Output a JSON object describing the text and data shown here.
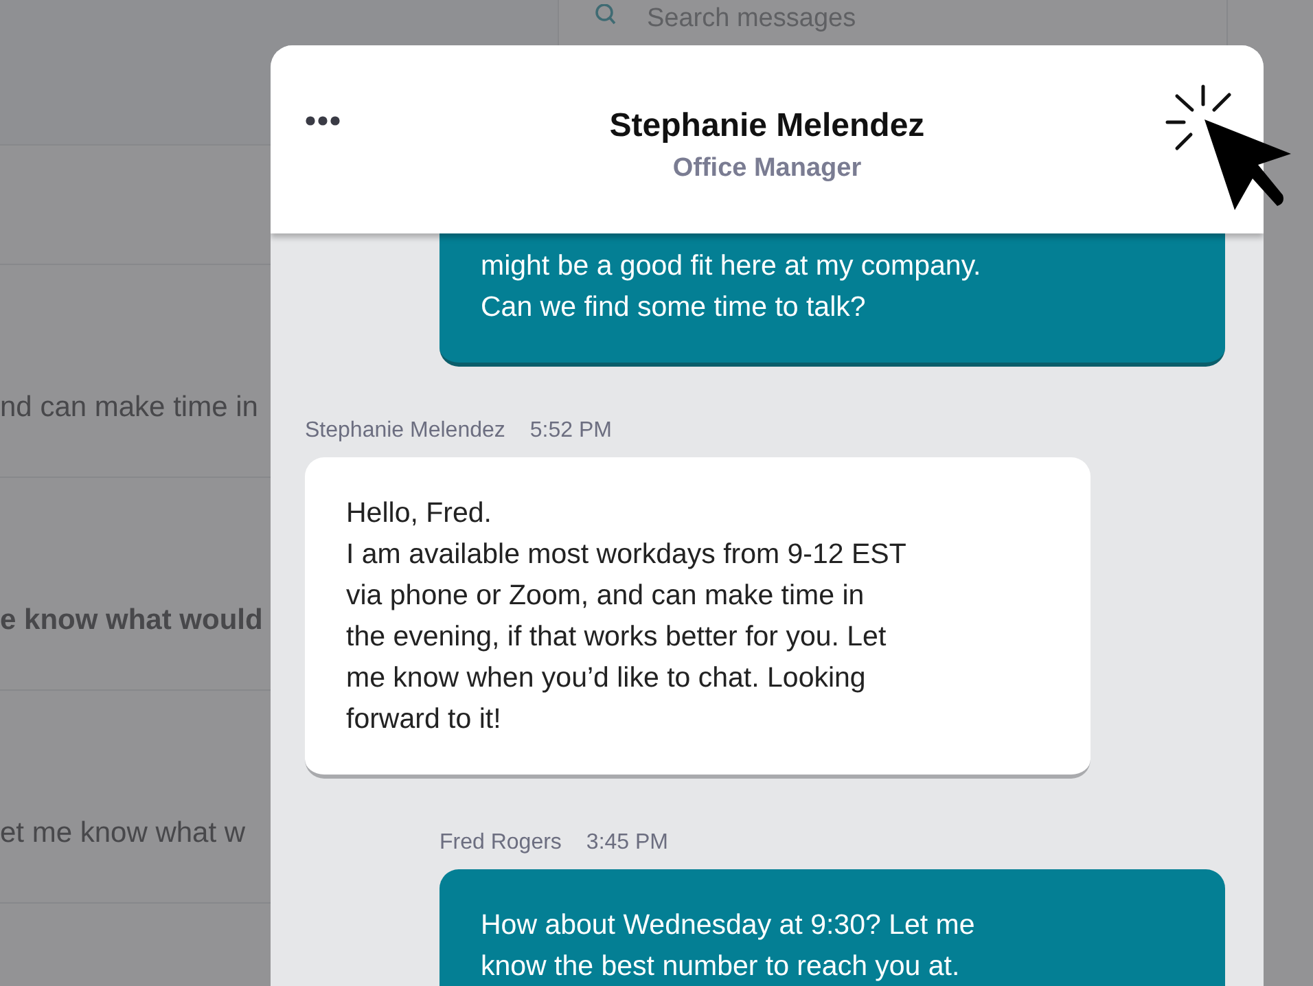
{
  "background": {
    "search": {
      "placeholder": "Search messages"
    },
    "list_rows": [
      {
        "snippet": "nd can make time in",
        "unread": false
      },
      {
        "snippet": "e know what would",
        "unread": true
      },
      {
        "snippet": "et me know what w",
        "unread": false
      }
    ]
  },
  "conversation": {
    "contact_name": "Stephanie Melendez",
    "contact_role": "Office Manager",
    "messages": [
      {
        "kind": "outgoing",
        "lines": [
          "might be a good fit here at my company.",
          "Can we find some time to talk?"
        ]
      },
      {
        "kind": "incoming",
        "sender": "Stephanie Melendez",
        "time": "5:52 PM",
        "lines": [
          "Hello, Fred.",
          "I am available most workdays from 9-12 EST",
          "via phone or Zoom, and can make time in",
          "the evening, if that works better for you. Let",
          "me know when you’d like to chat. Looking",
          "forward to it!"
        ]
      },
      {
        "kind": "outgoing",
        "sender": "Fred Rogers",
        "time": "3:45 PM",
        "lines": [
          "How about Wednesday at 9:30? Let me",
          "know the best number to reach you at."
        ]
      }
    ]
  }
}
